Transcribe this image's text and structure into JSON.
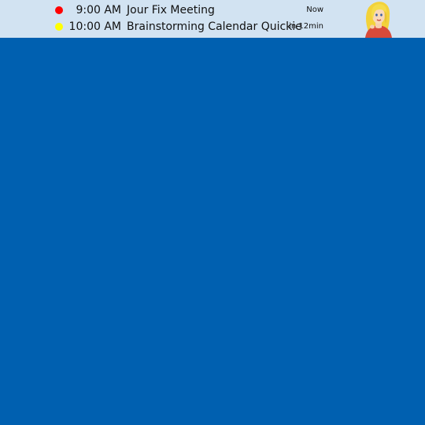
{
  "agenda": {
    "events": [
      {
        "time": "9:00 AM",
        "title": "Jour Fix Meeting",
        "when": "Now",
        "status_color": "#ff0000"
      },
      {
        "time": "10:00 AM",
        "title": "Brainstorming Calendar Quickie",
        "when": "in 12min",
        "status_color": "#ffff00"
      }
    ]
  },
  "colors": {
    "desktop_background": "#0060b0",
    "bar_background": "#d2e3f2"
  },
  "avatar": {
    "icon": "assistant-avatar-icon"
  }
}
